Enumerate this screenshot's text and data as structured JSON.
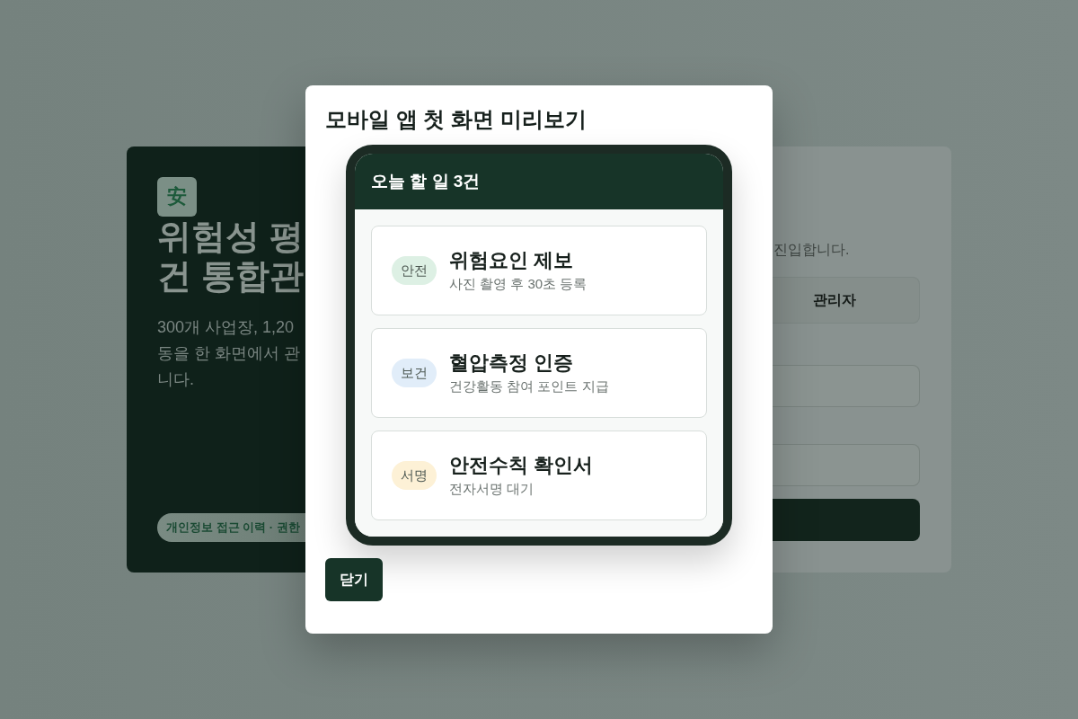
{
  "background_page": {
    "brand_mark": "安",
    "hero": {
      "title_lines": [
        "위험성 평",
        "건 통합관"
      ],
      "description_lines": [
        "300개 사업장, 1,20",
        "동을 한 화면에서 관",
        "니다."
      ],
      "notice": "개인정보 접근 이력 · 권한"
    },
    "login": {
      "hint": "진입합니다.",
      "role_button": "관리자"
    }
  },
  "modal": {
    "title": "모바일 앱 첫 화면 미리보기",
    "phone": {
      "header": "오늘 할 일 3건",
      "tasks": [
        {
          "tag": "안전",
          "color": "#ddf0e4",
          "title": "위험요인 제보",
          "subtitle": "사진 촬영 후 30초 등록"
        },
        {
          "tag": "보건",
          "color": "#e1edf9",
          "title": "혈압측정 인증",
          "subtitle": "건강활동 참여 포인트 지급"
        },
        {
          "tag": "서명",
          "color": "#fdf1d6",
          "title": "안전수칙 확인서",
          "subtitle": "전자서명 대기"
        }
      ]
    },
    "buttons": [
      "닫기"
    ]
  }
}
